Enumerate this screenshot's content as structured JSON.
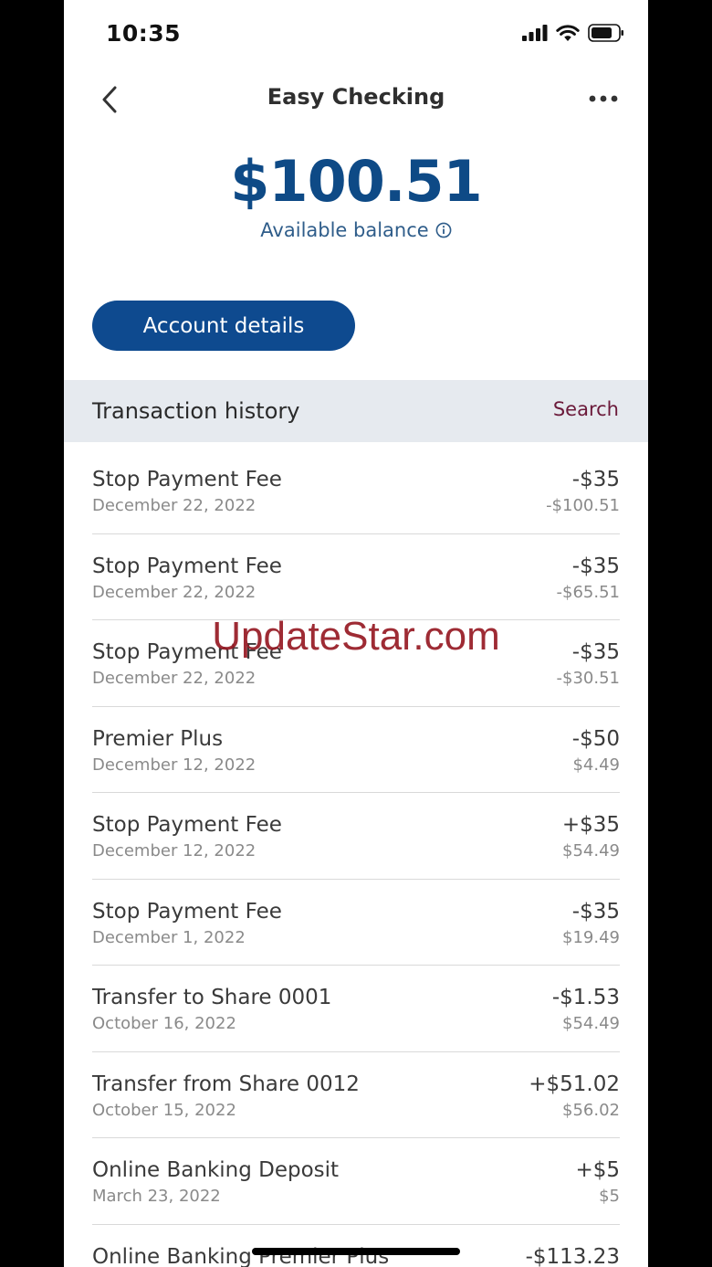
{
  "status_bar": {
    "time": "10:35",
    "icons": [
      "signal-icon",
      "wifi-icon",
      "battery-icon"
    ]
  },
  "nav": {
    "title": "Easy Checking",
    "back_icon": "chevron-left-icon",
    "more_icon": "more-horizontal-icon"
  },
  "balance": {
    "amount": "$100.51",
    "label": "Available balance",
    "info_icon": "info-icon"
  },
  "account_button": {
    "label": "Account details"
  },
  "transactions": {
    "header": "Transaction history",
    "search_label": "Search",
    "items": [
      {
        "description": "Stop Payment Fee",
        "date": "December 22, 2022",
        "amount": "-$35",
        "running_balance": "-$100.51"
      },
      {
        "description": "Stop Payment Fee",
        "date": "December 22, 2022",
        "amount": "-$35",
        "running_balance": "-$65.51"
      },
      {
        "description": "Stop Payment Fee",
        "date": "December 22, 2022",
        "amount": "-$35",
        "running_balance": "-$30.51"
      },
      {
        "description": "Premier Plus",
        "date": "December 12, 2022",
        "amount": "-$50",
        "running_balance": "$4.49"
      },
      {
        "description": "Stop Payment Fee",
        "date": "December 12, 2022",
        "amount": "+$35",
        "running_balance": "$54.49"
      },
      {
        "description": "Stop Payment Fee",
        "date": "December 1, 2022",
        "amount": "-$35",
        "running_balance": "$19.49"
      },
      {
        "description": "Transfer to Share 0001",
        "date": "October 16, 2022",
        "amount": "-$1.53",
        "running_balance": "$54.49"
      },
      {
        "description": "Transfer from Share 0012",
        "date": "October 15, 2022",
        "amount": "+$51.02",
        "running_balance": "$56.02"
      },
      {
        "description": "Online Banking Deposit",
        "date": "March 23, 2022",
        "amount": "+$5",
        "running_balance": "$5"
      },
      {
        "description": "Online Banking Premier Plus",
        "date": "",
        "amount": "-$113.23",
        "running_balance": ""
      }
    ]
  },
  "watermark": "UpdateStar.com",
  "colors": {
    "brand_blue": "#0e4a8f",
    "balance_blue": "#0e4a86",
    "search_accent": "#6b1a3a",
    "header_bg": "#e6eaef"
  }
}
